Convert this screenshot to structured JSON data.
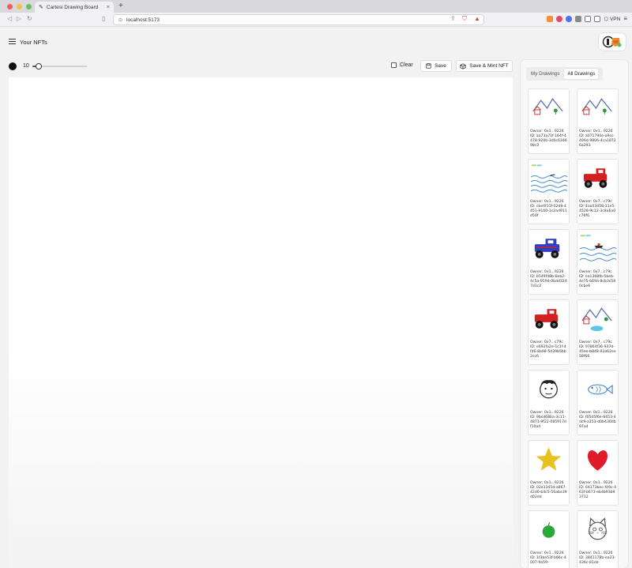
{
  "browser": {
    "tab_title": "Cartesi Drawing Board",
    "url": "localhost:5173",
    "vpn_label": "VPN"
  },
  "header": {
    "title": "Your NFTs"
  },
  "toolbar": {
    "brush_size": "10",
    "slider_value": 0.12,
    "clear_label": "Clear",
    "save_label": "Save",
    "save_mint_label": "Save & Mint NFT"
  },
  "panel": {
    "tabs": [
      {
        "label": "My Drawings"
      },
      {
        "label": "All Drawings"
      }
    ],
    "active_tab": "All Drawings",
    "cards": [
      {
        "owner": "Owner: 0x1...9226",
        "id": "ID: aa73a71f-164f-4478-920b-3d0c616698c3",
        "art": "mountains-house"
      },
      {
        "owner": "Owner: 0x1...9226",
        "id": "ID: a071790e-a9cc-406d-9806-4ca18726a293",
        "art": "mountains-house"
      },
      {
        "owner": "Owner: 0x1...9226",
        "id": "ID: cbe4f11f-02d8-4451-9160-1c2ad911d50f",
        "art": "sea"
      },
      {
        "owner": "Owner: 0x7...c79c",
        "id": "ID: 4aa03d58-11e5-4528-9c12-3c8a6a0c76f6",
        "art": "red-truck"
      },
      {
        "owner": "Owner: 0x1...9226",
        "id": "ID: b549f48b-6eb2-4c5a-919d-0bdd3247d1c2",
        "art": "blue-truck"
      },
      {
        "owner": "Owner: 0x7...c79c",
        "id": "ID: ea1368fb-5beb-4e75-b69a-8cb3c580cbe6",
        "art": "sea-boat"
      },
      {
        "owner": "Owner: 0x7...c79c",
        "id": "ID: e692fa2e-1c1f-4f46-8a98-5d39b5bb2cc6",
        "art": "red-truck"
      },
      {
        "owner": "Owner: 0x7...c79c",
        "id": "ID: 97864f36-937d-45ee-b848-93a62ee58f66",
        "art": "mountains-lake"
      },
      {
        "owner": "Owner: 0x1...9226",
        "id": "ID: 9bcd68ba-3c11-4871-9f22-085917df10a4",
        "art": "face"
      },
      {
        "owner": "Owner: 0x1...9226",
        "id": "ID: f05d5f6e-8453-4dc9-a153-d0b430db97a4",
        "art": "fish"
      },
      {
        "owner": "Owner: 0x1...9226",
        "id": "ID: 02e1345d-a867-42d0-b4c5-56abe39d02dd",
        "art": "star"
      },
      {
        "owner": "Owner: 0x1...9226",
        "id": "ID: 64173bec-f49c-463f-b673-eb4b93b93712",
        "art": "heart"
      },
      {
        "owner": "Owner: 0x1...9226",
        "id": "ID: 1f3be53f-b66c-4007-9a59-",
        "art": "apple"
      },
      {
        "owner": "Owner: 0x1...9226",
        "id": "ID: 3841178b-ea23-436c-81cb-",
        "art": "cat"
      }
    ]
  }
}
